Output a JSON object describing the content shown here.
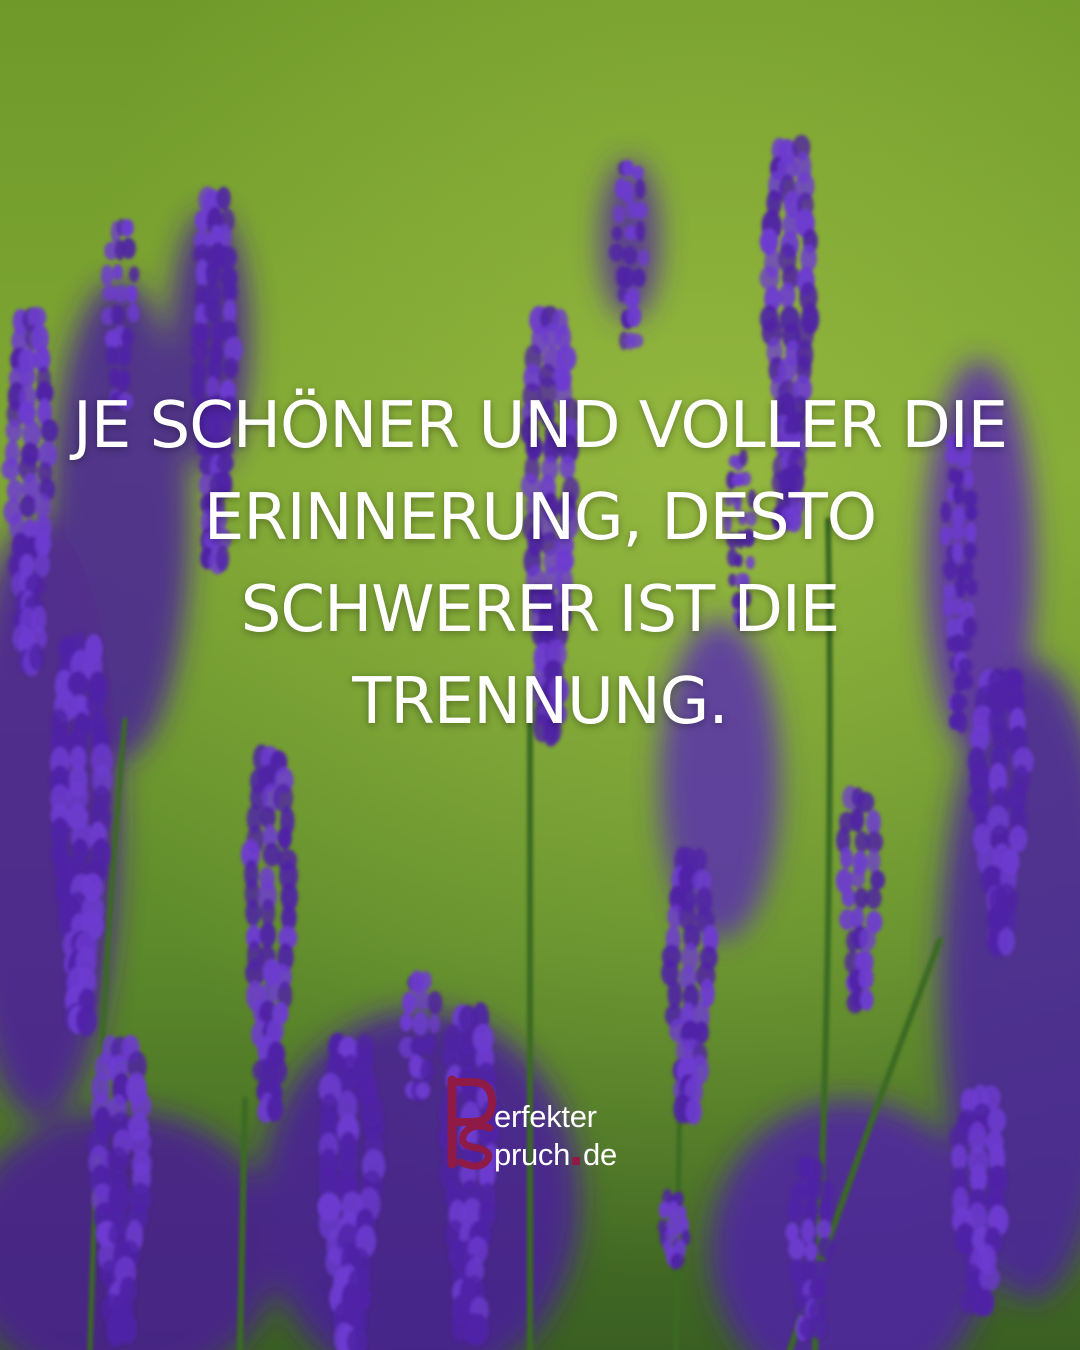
{
  "quote": {
    "lines": [
      "JE SCHÖNER UND VOLLER DIE",
      "ERINNERUNG, DESTO",
      "SCHWERER IST DIE",
      "TRENNUNG."
    ]
  },
  "logo": {
    "line1": "erfekter",
    "line2_main": "pruch",
    "line2_suffix": "de",
    "accent_color": "#8e1a45"
  },
  "colors": {
    "grass_light": "#8bb33c",
    "grass_dark": "#3f6a1f",
    "lavender": "#4f22a6",
    "lavender_light": "#6d3bd0",
    "stem": "#3b6a24",
    "text": "#ffffff"
  }
}
